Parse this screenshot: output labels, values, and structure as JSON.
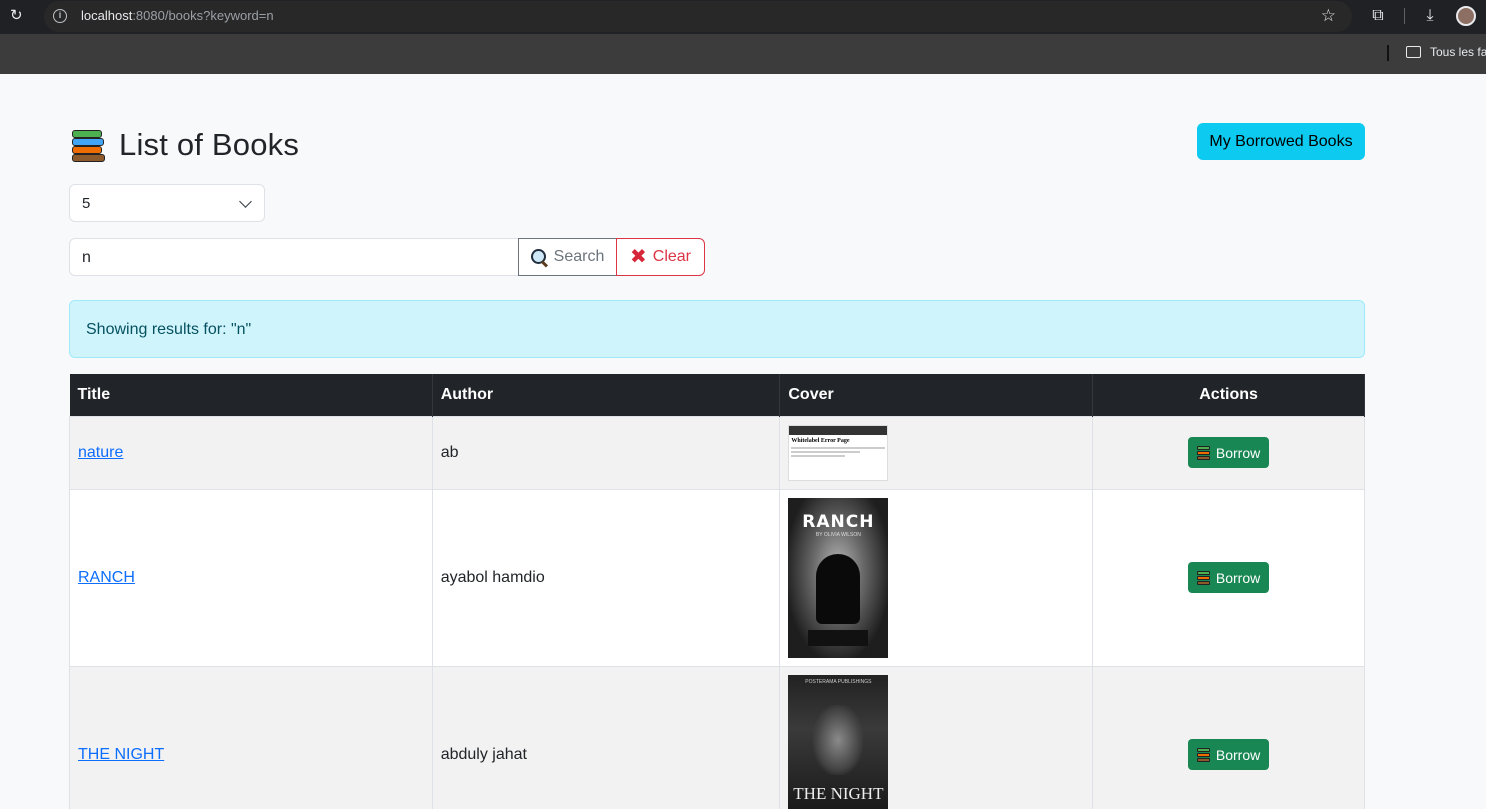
{
  "browser": {
    "url_host": "localhost",
    "url_rest": ":8080/books?keyword=n",
    "bookmarks_label": "Tous les fa"
  },
  "page": {
    "title": "List of Books",
    "borrowed_button": "My Borrowed Books",
    "page_size": "5",
    "search_value": "n",
    "search_button": "Search",
    "clear_button": "Clear",
    "alert": "Showing results for: \"n\""
  },
  "table": {
    "headers": {
      "title": "Title",
      "author": "Author",
      "cover": "Cover",
      "actions": "Actions"
    },
    "rows": [
      {
        "title": "nature",
        "author": "ab",
        "cover": "error-page-screenshot",
        "action": "Borrow"
      },
      {
        "title": "RANCH",
        "author": "ayabol hamdio",
        "cover": "ranch-cover",
        "action": "Borrow"
      },
      {
        "title": "THE NIGHT",
        "author": "abduly jahat",
        "cover": "the-night-cover",
        "action": "Borrow"
      }
    ]
  },
  "covers": {
    "nature_text": "Whitelabel Error Page",
    "ranch_title": "RANCH",
    "ranch_sub": "BY OLIVIA WILSON",
    "night_publisher": "POSTERAMA PUBLISHINGS",
    "night_title": "THE NIGHT"
  },
  "colors": {
    "accent_info": "#0dcaf0",
    "success": "#198754",
    "danger": "#dc3545",
    "table_header": "#212529"
  }
}
